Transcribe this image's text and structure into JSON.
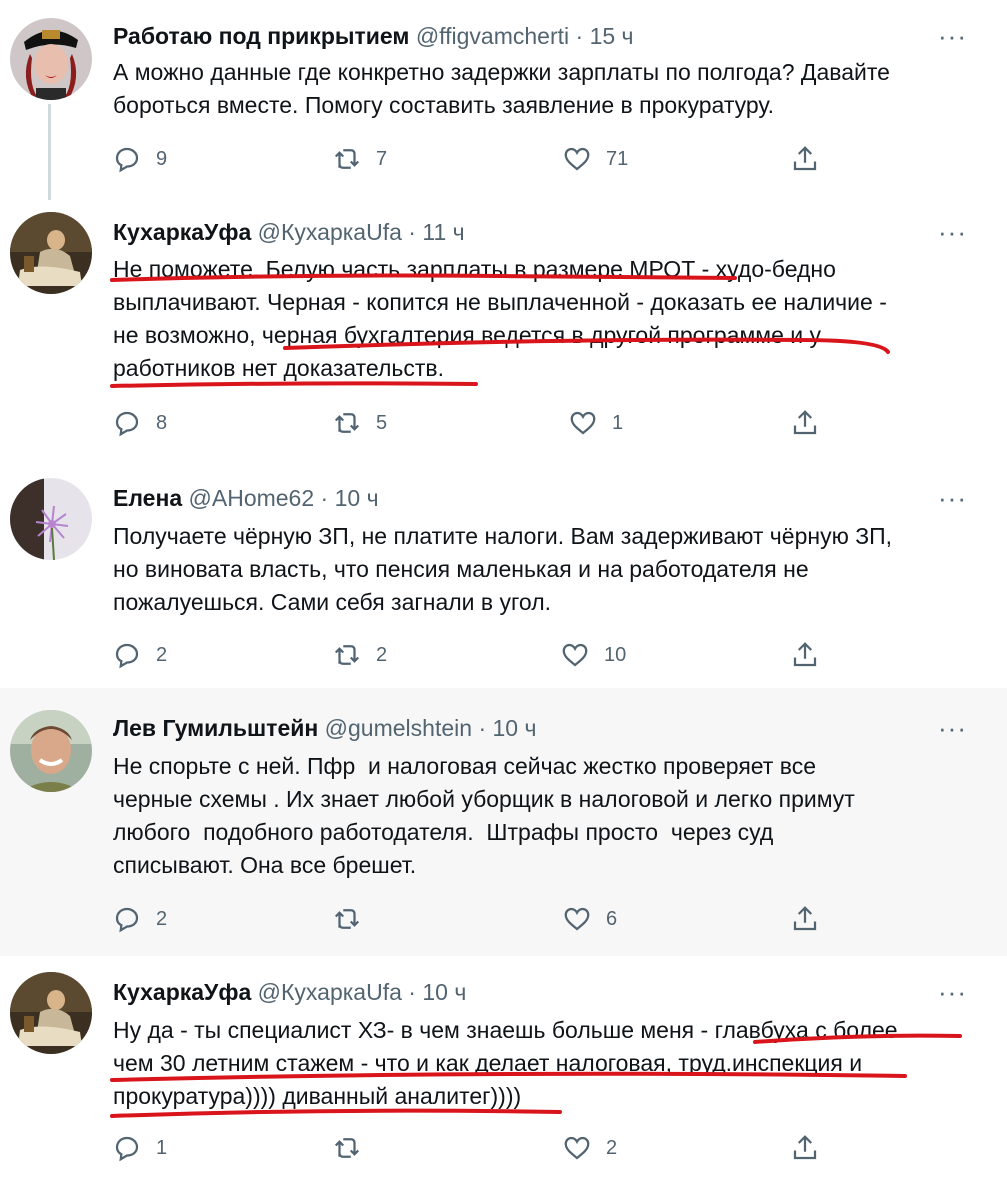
{
  "tweets": [
    {
      "name": "Работаю под прикрытием",
      "handle": "@ffigvamcherti",
      "sep": "·",
      "time": "15 ч",
      "more": "···",
      "lines": [
        "А можно данные где конкретно задержки зарплаты по полгода? Давайте",
        "бороться вместе. Помогу составить заявление в прокуратуру."
      ],
      "replies": "9",
      "retweets": "7",
      "likes": "71"
    },
    {
      "name": "КухаркаУфа",
      "handle": "@КухаркаUfa",
      "sep": "·",
      "time": "11 ч",
      "more": "···",
      "lines": [
        "Не поможете. Белую часть зарплаты в размере МРОТ - худо-бедно",
        "выплачивают. Черная - копится не выплаченной - доказать ее наличие -",
        "не возможно, черная бухгалтерия ведется в другой программе и у",
        "работников нет доказательств."
      ],
      "replies": "8",
      "retweets": "5",
      "likes": "1"
    },
    {
      "name": "Елена",
      "handle": "@AHome62",
      "sep": "·",
      "time": "10 ч",
      "more": "···",
      "lines": [
        "Получаете чёрную ЗП, не платите налоги. Вам задерживают чёрную ЗП,",
        "но виновата власть, что пенсия маленькая и на работодателя не",
        "пожалуешься. Сами себя загнали в угол."
      ],
      "replies": "2",
      "retweets": "2",
      "likes": "10"
    },
    {
      "name": "Лев Гумильштейн",
      "handle": "@gumelshtein",
      "sep": "·",
      "time": "10 ч",
      "more": "···",
      "lines": [
        "Не спорьте с ней. Пфр  и налоговая сейчас жестко проверяет все",
        "черные схемы . Их знает любой уборщик в налоговой и легко примут",
        "любого  подобного работодателя.  Штрафы просто  через суд",
        "списывают. Она все брешет."
      ],
      "replies": "2",
      "retweets": "",
      "likes": "6"
    },
    {
      "name": "КухаркаУфа",
      "handle": "@КухаркаUfa",
      "sep": "·",
      "time": "10 ч",
      "more": "···",
      "lines": [
        "Ну да - ты специалист ХЗ- в чем знаешь больше меня - главбуха с более",
        "чем 30 летним стажем - что и как делает налоговая, труд.инспекция и",
        "прокуратура)))) диванный аналитег))))"
      ],
      "replies": "1",
      "retweets": "",
      "likes": "2"
    }
  ],
  "colors": {
    "text": "#0f1419",
    "secondary": "#536471",
    "highlight_bg": "#f7f7f7",
    "annotation": "#d9141b",
    "thread_line": "#cfd9de"
  }
}
